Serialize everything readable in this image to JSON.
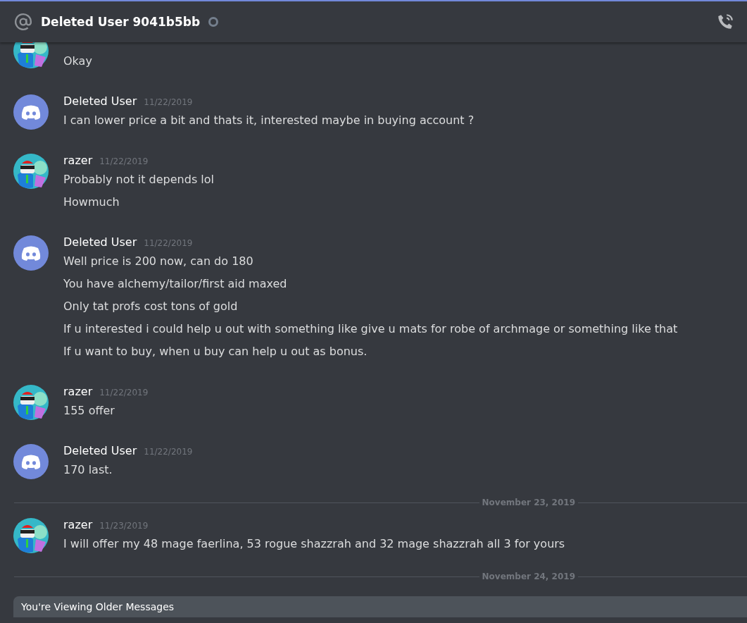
{
  "header": {
    "title": "Deleted User 9041b5bb",
    "online": false
  },
  "feed": [
    {
      "kind": "message",
      "avatar": {
        "kind": "razer"
      },
      "lines": [
        "Okay"
      ]
    },
    {
      "kind": "message",
      "avatar": {
        "kind": "discord"
      },
      "author": "Deleted User",
      "date": "11/22/2019",
      "lines": [
        "I can lower price a bit and thats it, interested maybe in buying account ?"
      ]
    },
    {
      "kind": "message",
      "avatar": {
        "kind": "razer"
      },
      "author": "razer",
      "date": "11/22/2019",
      "lines": [
        "Probably not it depends lol",
        "Howmuch"
      ]
    },
    {
      "kind": "message",
      "avatar": {
        "kind": "discord"
      },
      "author": "Deleted User",
      "date": "11/22/2019",
      "lines": [
        "Well price is 200 now, can do 180",
        "You have alchemy/tailor/first aid maxed",
        "Only tat profs cost tons of gold",
        "If u interested i could help u out with something like give u mats for robe of archmage or something like that",
        "If u want to buy, when u buy can help u out as bonus."
      ]
    },
    {
      "kind": "message",
      "avatar": {
        "kind": "razer"
      },
      "author": "razer",
      "date": "11/22/2019",
      "lines": [
        "155 offer"
      ]
    },
    {
      "kind": "message",
      "avatar": {
        "kind": "discord"
      },
      "author": "Deleted User",
      "date": "11/22/2019",
      "lines": [
        "170 last."
      ]
    },
    {
      "kind": "divider",
      "label": "November 23, 2019"
    },
    {
      "kind": "message",
      "avatar": {
        "kind": "razer"
      },
      "author": "razer",
      "date": "11/23/2019",
      "lines": [
        "I will offer my 48 mage faerlina, 53 rogue shazzrah and 32 mage shazzrah all 3 for yours"
      ]
    },
    {
      "kind": "divider",
      "label": "November 24, 2019"
    }
  ],
  "older_bar": {
    "label": "You're Viewing Older Messages"
  }
}
